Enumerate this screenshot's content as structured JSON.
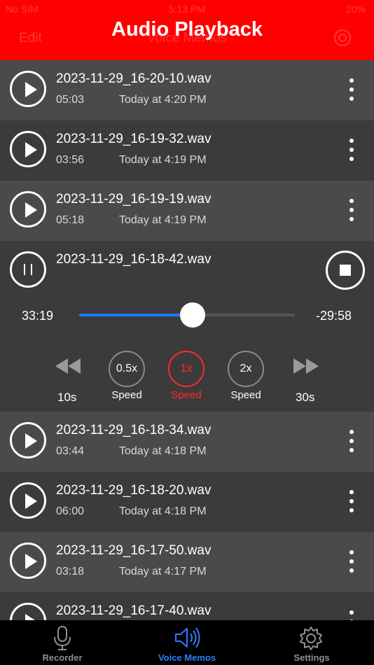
{
  "status_bar": {
    "carrier": "No SIM",
    "time": "5:13 PM",
    "battery": "20%"
  },
  "header": {
    "title": "Audio Playback",
    "ghost_edit": "Edit",
    "ghost_title": "Voice Memos"
  },
  "recordings_top": [
    {
      "filename": "2023-11-29_16-20-10.wav",
      "duration": "05:03",
      "date": "Today at 4:20 PM"
    },
    {
      "filename": "2023-11-29_16-19-32.wav",
      "duration": "03:56",
      "date": "Today at 4:19 PM"
    },
    {
      "filename": "2023-11-29_16-19-19.wav",
      "duration": "05:18",
      "date": "Today at 4:19 PM"
    }
  ],
  "player": {
    "filename": "2023-11-29_16-18-42.wav",
    "elapsed": "33:19",
    "remaining": "-29:58",
    "progress_fraction": 0.527,
    "rewind_label": "10s",
    "forward_label": "30s",
    "speeds": [
      {
        "value": "0.5x",
        "label": "Speed",
        "active": false
      },
      {
        "value": "1x",
        "label": "Speed",
        "active": true
      },
      {
        "value": "2x",
        "label": "Speed",
        "active": false
      }
    ],
    "accent_color": "#1a7bff",
    "active_speed_color": "#ff2a2a"
  },
  "recordings_bottom": [
    {
      "filename": "2023-11-29_16-18-34.wav",
      "duration": "03:44",
      "date": "Today at 4:18 PM"
    },
    {
      "filename": "2023-11-29_16-18-20.wav",
      "duration": "06:00",
      "date": "Today at 4:18 PM"
    },
    {
      "filename": "2023-11-29_16-17-50.wav",
      "duration": "03:18",
      "date": "Today at 4:17 PM"
    },
    {
      "filename": "2023-11-29_16-17-40.wav",
      "duration": "",
      "date": ""
    }
  ],
  "tabs": [
    {
      "label": "Recorder",
      "icon": "microphone-icon",
      "active": false
    },
    {
      "label": "Voice Memos",
      "icon": "speaker-icon",
      "active": true
    },
    {
      "label": "Settings",
      "icon": "gear-icon",
      "active": false
    }
  ],
  "colors": {
    "header": "#ff0000",
    "tab_active": "#2f7bff",
    "tab_inactive": "#8e8e93"
  }
}
